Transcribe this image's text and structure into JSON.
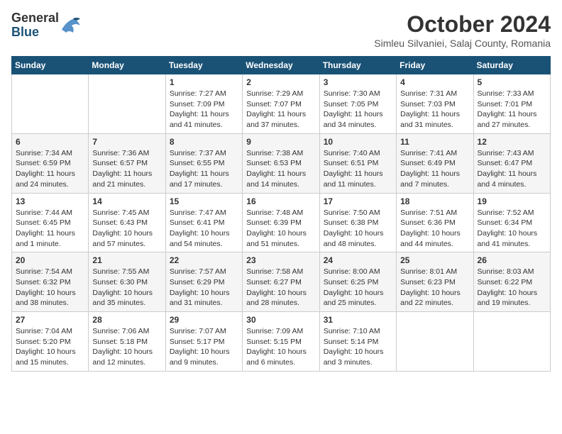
{
  "header": {
    "logo": {
      "general": "General",
      "blue": "Blue"
    },
    "title": "October 2024",
    "location": "Simleu Silvaniei, Salaj County, Romania"
  },
  "weekdays": [
    "Sunday",
    "Monday",
    "Tuesday",
    "Wednesday",
    "Thursday",
    "Friday",
    "Saturday"
  ],
  "weeks": [
    [
      {
        "day": "",
        "info": ""
      },
      {
        "day": "",
        "info": ""
      },
      {
        "day": "1",
        "sunrise": "7:27 AM",
        "sunset": "7:09 PM",
        "daylight": "11 hours and 41 minutes."
      },
      {
        "day": "2",
        "sunrise": "7:29 AM",
        "sunset": "7:07 PM",
        "daylight": "11 hours and 37 minutes."
      },
      {
        "day": "3",
        "sunrise": "7:30 AM",
        "sunset": "7:05 PM",
        "daylight": "11 hours and 34 minutes."
      },
      {
        "day": "4",
        "sunrise": "7:31 AM",
        "sunset": "7:03 PM",
        "daylight": "11 hours and 31 minutes."
      },
      {
        "day": "5",
        "sunrise": "7:33 AM",
        "sunset": "7:01 PM",
        "daylight": "11 hours and 27 minutes."
      }
    ],
    [
      {
        "day": "6",
        "sunrise": "7:34 AM",
        "sunset": "6:59 PM",
        "daylight": "11 hours and 24 minutes."
      },
      {
        "day": "7",
        "sunrise": "7:36 AM",
        "sunset": "6:57 PM",
        "daylight": "11 hours and 21 minutes."
      },
      {
        "day": "8",
        "sunrise": "7:37 AM",
        "sunset": "6:55 PM",
        "daylight": "11 hours and 17 minutes."
      },
      {
        "day": "9",
        "sunrise": "7:38 AM",
        "sunset": "6:53 PM",
        "daylight": "11 hours and 14 minutes."
      },
      {
        "day": "10",
        "sunrise": "7:40 AM",
        "sunset": "6:51 PM",
        "daylight": "11 hours and 11 minutes."
      },
      {
        "day": "11",
        "sunrise": "7:41 AM",
        "sunset": "6:49 PM",
        "daylight": "11 hours and 7 minutes."
      },
      {
        "day": "12",
        "sunrise": "7:43 AM",
        "sunset": "6:47 PM",
        "daylight": "11 hours and 4 minutes."
      }
    ],
    [
      {
        "day": "13",
        "sunrise": "7:44 AM",
        "sunset": "6:45 PM",
        "daylight": "11 hours and 1 minute."
      },
      {
        "day": "14",
        "sunrise": "7:45 AM",
        "sunset": "6:43 PM",
        "daylight": "10 hours and 57 minutes."
      },
      {
        "day": "15",
        "sunrise": "7:47 AM",
        "sunset": "6:41 PM",
        "daylight": "10 hours and 54 minutes."
      },
      {
        "day": "16",
        "sunrise": "7:48 AM",
        "sunset": "6:39 PM",
        "daylight": "10 hours and 51 minutes."
      },
      {
        "day": "17",
        "sunrise": "7:50 AM",
        "sunset": "6:38 PM",
        "daylight": "10 hours and 48 minutes."
      },
      {
        "day": "18",
        "sunrise": "7:51 AM",
        "sunset": "6:36 PM",
        "daylight": "10 hours and 44 minutes."
      },
      {
        "day": "19",
        "sunrise": "7:52 AM",
        "sunset": "6:34 PM",
        "daylight": "10 hours and 41 minutes."
      }
    ],
    [
      {
        "day": "20",
        "sunrise": "7:54 AM",
        "sunset": "6:32 PM",
        "daylight": "10 hours and 38 minutes."
      },
      {
        "day": "21",
        "sunrise": "7:55 AM",
        "sunset": "6:30 PM",
        "daylight": "10 hours and 35 minutes."
      },
      {
        "day": "22",
        "sunrise": "7:57 AM",
        "sunset": "6:29 PM",
        "daylight": "10 hours and 31 minutes."
      },
      {
        "day": "23",
        "sunrise": "7:58 AM",
        "sunset": "6:27 PM",
        "daylight": "10 hours and 28 minutes."
      },
      {
        "day": "24",
        "sunrise": "8:00 AM",
        "sunset": "6:25 PM",
        "daylight": "10 hours and 25 minutes."
      },
      {
        "day": "25",
        "sunrise": "8:01 AM",
        "sunset": "6:23 PM",
        "daylight": "10 hours and 22 minutes."
      },
      {
        "day": "26",
        "sunrise": "8:03 AM",
        "sunset": "6:22 PM",
        "daylight": "10 hours and 19 minutes."
      }
    ],
    [
      {
        "day": "27",
        "sunrise": "7:04 AM",
        "sunset": "5:20 PM",
        "daylight": "10 hours and 15 minutes."
      },
      {
        "day": "28",
        "sunrise": "7:06 AM",
        "sunset": "5:18 PM",
        "daylight": "10 hours and 12 minutes."
      },
      {
        "day": "29",
        "sunrise": "7:07 AM",
        "sunset": "5:17 PM",
        "daylight": "10 hours and 9 minutes."
      },
      {
        "day": "30",
        "sunrise": "7:09 AM",
        "sunset": "5:15 PM",
        "daylight": "10 hours and 6 minutes."
      },
      {
        "day": "31",
        "sunrise": "7:10 AM",
        "sunset": "5:14 PM",
        "daylight": "10 hours and 3 minutes."
      },
      {
        "day": "",
        "info": ""
      },
      {
        "day": "",
        "info": ""
      }
    ]
  ]
}
